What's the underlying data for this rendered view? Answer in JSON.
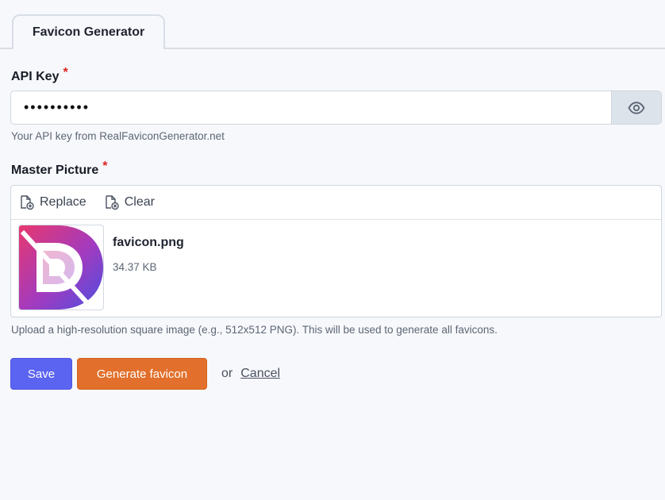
{
  "tab": {
    "label": "Favicon Generator"
  },
  "api_key": {
    "label": "API Key",
    "required_mark": "*",
    "value": "••••••••••",
    "toggle_icon": "eye-icon",
    "help": "Your API key from RealFaviconGenerator.net"
  },
  "master_picture": {
    "label": "Master Picture",
    "required_mark": "*",
    "replace_label": "Replace",
    "replace_icon": "file-add-icon",
    "clear_label": "Clear",
    "clear_icon": "file-clear-icon",
    "file": {
      "name": "favicon.png",
      "size": "34.37 KB"
    },
    "help": "Upload a high-resolution square image (e.g., 512x512 PNG). This will be used to generate all favicons."
  },
  "actions": {
    "save_label": "Save",
    "generate_label": "Generate favicon",
    "or_text": "or",
    "cancel_label": "Cancel"
  },
  "colors": {
    "save": "#5b64f0",
    "generate": "#e2702c",
    "required": "#e02424"
  }
}
